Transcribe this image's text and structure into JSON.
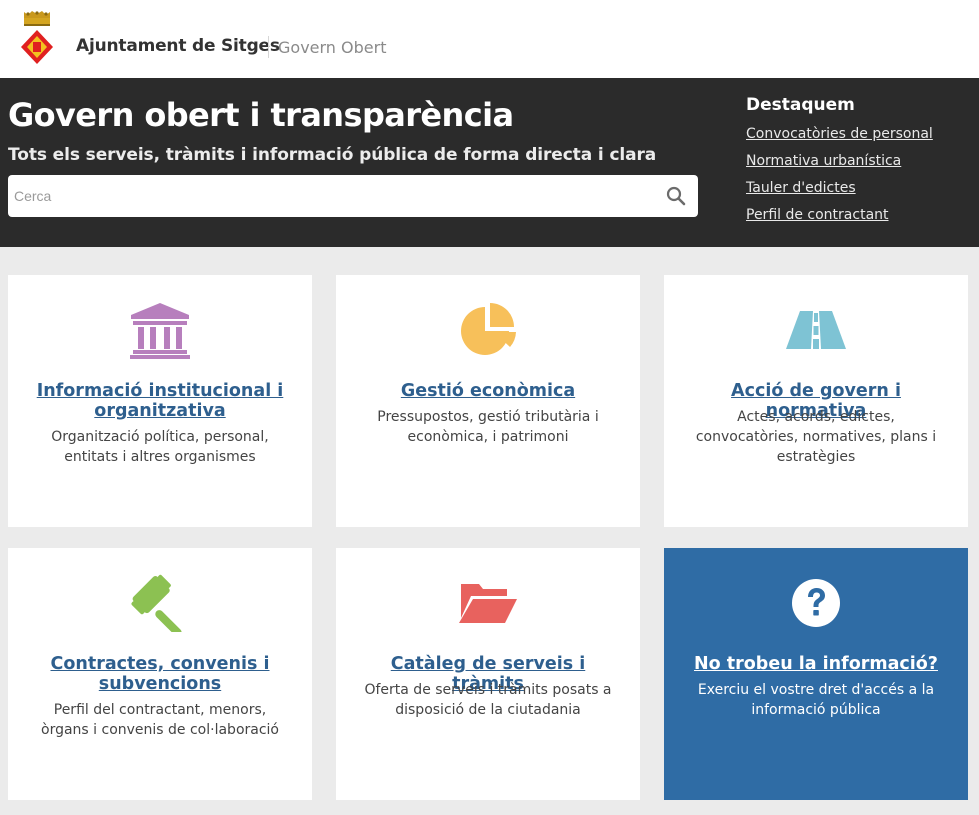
{
  "header": {
    "brand": "Ajuntament de Sitges",
    "section": "Govern Obert"
  },
  "hero": {
    "title": "Govern obert i transparència",
    "subtitle": "Tots els serveis, tràmits i informació pública de forma directa i clara",
    "search_placeholder": "Cerca",
    "search_value": ""
  },
  "featured": {
    "title": "Destaquem",
    "links": [
      "Convocatòries de personal",
      "Normativa urbanística",
      "Tauler d'edictes",
      "Perfil de contractant"
    ]
  },
  "cards": [
    {
      "title": "Informació institucional i organitzativa",
      "description": "Organització política, personal, entitats i altres organismes",
      "icon": "institution-building-icon",
      "color": "#b77fbd"
    },
    {
      "title": "Gestió econòmica",
      "description": "Pressupostos, gestió tributària i econòmica, i patrimoni",
      "icon": "pie-chart-icon",
      "color": "#f7c05a"
    },
    {
      "title": "Acció de govern i normativa",
      "description": "Actes, acords, edictes, convocatòries, normatives, plans i estratègies",
      "icon": "road-icon",
      "color": "#7ec3d4"
    },
    {
      "title": "Contractes, convenis i subvencions",
      "description": "Perfil del contractant, menors, òrgans i convenis de col·laboració",
      "icon": "gavel-icon",
      "color": "#8cc152"
    },
    {
      "title": "Catàleg de serveis i tràmits",
      "description": "Oferta de serveis i tràmits posats a disposició de la ciutadania",
      "icon": "folder-open-icon",
      "color": "#e8625e"
    },
    {
      "title": "No trobeu la informació?",
      "description": "Exerciu el vostre dret d'accés a la informació pública",
      "icon": "question-circle-icon",
      "color": "#2f6ca5"
    }
  ],
  "colors": {
    "hero_bg": "#2b2b2b",
    "link_blue": "#2e5f8e",
    "highlight_card": "#2f6ca5",
    "page_bg": "#ebebeb"
  }
}
